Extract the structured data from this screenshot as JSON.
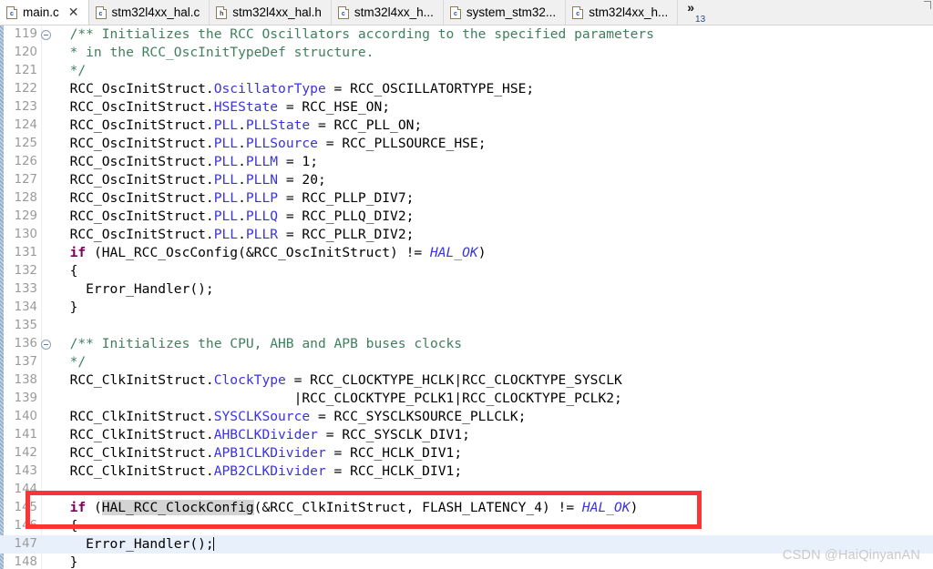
{
  "tabs": [
    {
      "label": "main.c",
      "icon": "c-file-icon",
      "kind": "c",
      "active": true,
      "closable": true
    },
    {
      "label": "stm32l4xx_hal.c",
      "icon": "c-file-icon",
      "kind": "c",
      "active": false,
      "closable": false
    },
    {
      "label": "stm32l4xx_hal.h",
      "icon": "h-file-icon",
      "kind": "h",
      "active": false,
      "closable": false
    },
    {
      "label": "stm32l4xx_h...",
      "icon": "c-file-icon",
      "kind": "c",
      "active": false,
      "closable": false
    },
    {
      "label": "system_stm32...",
      "icon": "c-file-icon",
      "kind": "c",
      "active": false,
      "closable": false
    },
    {
      "label": "stm32l4xx_h...",
      "icon": "c-file-icon",
      "kind": "c",
      "active": false,
      "closable": false
    }
  ],
  "tab_overflow": {
    "chevron": "»",
    "count": "13"
  },
  "tab_close_glyph": "✕",
  "editor": {
    "first_line_number": 119,
    "current_line_number": 147,
    "fold_marker_lines": [
      119,
      136
    ],
    "lines": [
      {
        "n": 119,
        "text": "  /** Initializes the RCC Oscillators according to the specified parameters"
      },
      {
        "n": 120,
        "text": "  * in the RCC_OscInitTypeDef structure."
      },
      {
        "n": 121,
        "text": "  */"
      },
      {
        "n": 122,
        "text": "  RCC_OscInitStruct.OscillatorType = RCC_OSCILLATORTYPE_HSE;"
      },
      {
        "n": 123,
        "text": "  RCC_OscInitStruct.HSEState = RCC_HSE_ON;"
      },
      {
        "n": 124,
        "text": "  RCC_OscInitStruct.PLL.PLLState = RCC_PLL_ON;"
      },
      {
        "n": 125,
        "text": "  RCC_OscInitStruct.PLL.PLLSource = RCC_PLLSOURCE_HSE;"
      },
      {
        "n": 126,
        "text": "  RCC_OscInitStruct.PLL.PLLM = 1;"
      },
      {
        "n": 127,
        "text": "  RCC_OscInitStruct.PLL.PLLN = 20;"
      },
      {
        "n": 128,
        "text": "  RCC_OscInitStruct.PLL.PLLP = RCC_PLLP_DIV7;"
      },
      {
        "n": 129,
        "text": "  RCC_OscInitStruct.PLL.PLLQ = RCC_PLLQ_DIV2;"
      },
      {
        "n": 130,
        "text": "  RCC_OscInitStruct.PLL.PLLR = RCC_PLLR_DIV2;"
      },
      {
        "n": 131,
        "text": "  if (HAL_RCC_OscConfig(&RCC_OscInitStruct) != HAL_OK)"
      },
      {
        "n": 132,
        "text": "  {"
      },
      {
        "n": 133,
        "text": "    Error_Handler();"
      },
      {
        "n": 134,
        "text": "  }"
      },
      {
        "n": 135,
        "text": ""
      },
      {
        "n": 136,
        "text": "  /** Initializes the CPU, AHB and APB buses clocks"
      },
      {
        "n": 137,
        "text": "  */"
      },
      {
        "n": 138,
        "text": "  RCC_ClkInitStruct.ClockType = RCC_CLOCKTYPE_HCLK|RCC_CLOCKTYPE_SYSCLK"
      },
      {
        "n": 139,
        "text": "                              |RCC_CLOCKTYPE_PCLK1|RCC_CLOCKTYPE_PCLK2;"
      },
      {
        "n": 140,
        "text": "  RCC_ClkInitStruct.SYSCLKSource = RCC_SYSCLKSOURCE_PLLCLK;"
      },
      {
        "n": 141,
        "text": "  RCC_ClkInitStruct.AHBCLKDivider = RCC_SYSCLK_DIV1;"
      },
      {
        "n": 142,
        "text": "  RCC_ClkInitStruct.APB1CLKDivider = RCC_HCLK_DIV1;"
      },
      {
        "n": 143,
        "text": "  RCC_ClkInitStruct.APB2CLKDivider = RCC_HCLK_DIV1;"
      },
      {
        "n": 144,
        "text": ""
      },
      {
        "n": 145,
        "text": "  if (HAL_RCC_ClockConfig(&RCC_ClkInitStruct, FLASH_LATENCY_4) != HAL_OK)"
      },
      {
        "n": 146,
        "text": "  {"
      },
      {
        "n": 147,
        "text": "    Error_Handler();"
      },
      {
        "n": 148,
        "text": "  }"
      }
    ],
    "occurrence_highlight": "HAL_RCC_ClockConfig"
  },
  "annotation": {
    "type": "red-rectangle",
    "color": "#FC3433",
    "covers_line": 145
  },
  "watermark": {
    "text": "CSDN @HaiQinyanAN",
    "color": "#C9C9C9"
  },
  "colors": {
    "comment": "#3F7F5F",
    "keyword": "#7F0055",
    "member": "#3A33DF",
    "constant": "#3A33DF",
    "current_line": "#E8F0FC",
    "occurrence": "#D4D4D4",
    "background": "#FFFFFF",
    "tabbar": "#F0F0F0"
  }
}
